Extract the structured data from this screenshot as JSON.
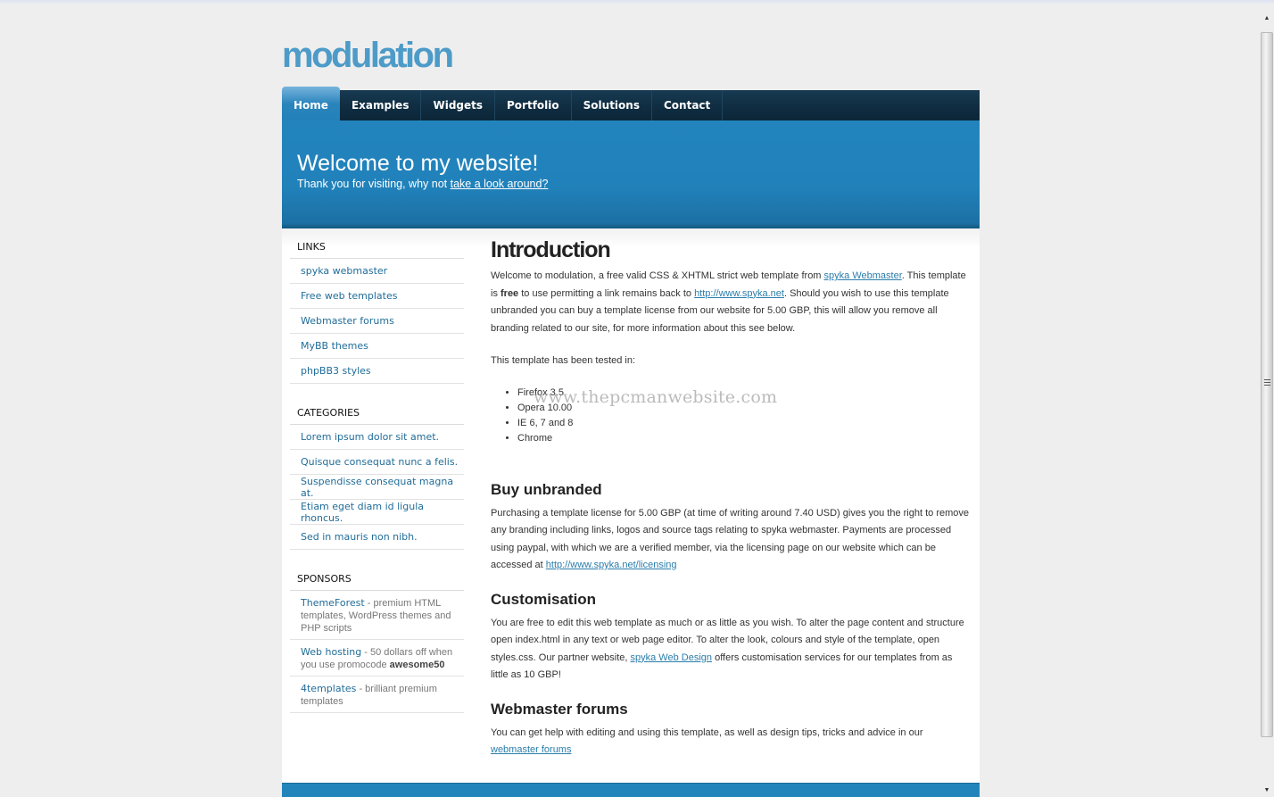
{
  "site": {
    "logo": "modulation"
  },
  "nav": {
    "items": [
      {
        "label": "Home",
        "active": true
      },
      {
        "label": "Examples"
      },
      {
        "label": "Widgets"
      },
      {
        "label": "Portfolio"
      },
      {
        "label": "Solutions"
      },
      {
        "label": "Contact"
      }
    ]
  },
  "banner": {
    "title": "Welcome to my website!",
    "subtitle_text": "Thank you for visiting, why not ",
    "subtitle_link": "take a look around?"
  },
  "sidebar": {
    "links": {
      "heading": "LINKS",
      "items": [
        "spyka webmaster",
        "Free web templates",
        "Webmaster forums",
        "MyBB themes",
        "phpBB3 styles"
      ]
    },
    "categories": {
      "heading": "CATEGORIES",
      "items": [
        "Lorem ipsum dolor sit amet.",
        "Quisque consequat nunc a felis.",
        "Suspendisse consequat magna at.",
        "Etiam eget diam id ligula rhoncus.",
        "Sed in mauris non nibh."
      ]
    },
    "sponsors": {
      "heading": "SPONSORS",
      "items": [
        {
          "link": "ThemeForest",
          "text": " - premium HTML templates, WordPress themes and PHP scripts",
          "bold": ""
        },
        {
          "link": "Web hosting",
          "text": " - 50 dollars off when you use promocode ",
          "bold": "awesome50"
        },
        {
          "link": "4templates",
          "text": " - brilliant premium templates",
          "bold": ""
        }
      ]
    }
  },
  "content": {
    "intro": {
      "heading": "Introduction",
      "p1_a": "Welcome to modulation, a free valid CSS & XHTML strict web template from ",
      "p1_link1": "spyka Webmaster",
      "p1_b": ". This template is ",
      "p1_bold": "free",
      "p1_c": " to use permitting a link remains back to ",
      "p1_link2": "http://www.spyka.net",
      "p1_d": ". Should you wish to use this template unbranded you can buy a template license from our website for 5.00 GBP, this will allow you remove all branding related to our site, for more information about this see below.",
      "p2": "This template has been tested in:",
      "browsers": [
        "Firefox 3.5",
        "Opera 10.00",
        "IE 6, 7 and 8",
        "Chrome"
      ]
    },
    "unbranded": {
      "heading": "Buy unbranded",
      "text": "Purchasing a template license for 5.00 GBP (at time of writing around 7.40 USD) gives you the right to remove any branding including links, logos and source tags relating to spyka webmaster. Payments are processed using paypal, with which we are a verified member, via the licensing page on our website which can be accessed at ",
      "link": "http://www.spyka.net/licensing"
    },
    "custom": {
      "heading": "Customisation",
      "text_a": "You are free to edit this web template as much or as little as you wish. To alter the page content and structure open index.html in any text or web page editor. To alter the look, colours and style of the template, open styles.css. Our partner website, ",
      "link": "spyka Web Design",
      "text_b": " offers customisation services for our templates from as little as 10 GBP!"
    },
    "forums": {
      "heading": "Webmaster forums",
      "text": "You can get help with editing and using this template, as well as design tips, tricks and advice in our ",
      "link": "webmaster forums"
    }
  },
  "watermark": "www.thepcmanwebsite.com",
  "colors": {
    "brand_blue": "#2384bb",
    "logo_blue": "#4d9bc8",
    "nav_dark": "#0f2c40",
    "link": "#216d99"
  }
}
